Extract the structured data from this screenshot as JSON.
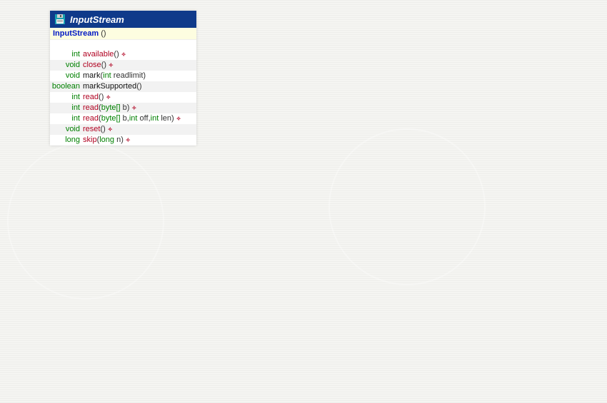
{
  "header": {
    "title": "InputStream",
    "icon": "floppy-disk-icon"
  },
  "constructor": {
    "name": "InputStream",
    "params": "()"
  },
  "methods": [
    {
      "ret": "int",
      "name": "available",
      "nameColor": "red",
      "params": [],
      "throws": true
    },
    {
      "ret": "void",
      "name": "close",
      "nameColor": "red",
      "params": [],
      "throws": true
    },
    {
      "ret": "void",
      "name": "mark",
      "nameColor": "black",
      "params": [
        {
          "type": "int",
          "name": "readlimit"
        }
      ],
      "throws": false
    },
    {
      "ret": "boolean",
      "name": "markSupported",
      "nameColor": "black",
      "params": [],
      "throws": false
    },
    {
      "ret": "int",
      "name": "read",
      "nameColor": "red",
      "params": [],
      "throws": true
    },
    {
      "ret": "int",
      "name": "read",
      "nameColor": "red",
      "params": [
        {
          "type": "byte[]",
          "name": "b"
        }
      ],
      "throws": true
    },
    {
      "ret": "int",
      "name": "read",
      "nameColor": "red",
      "params": [
        {
          "type": "byte[]",
          "name": "b"
        },
        {
          "type": "int",
          "name": "off"
        },
        {
          "type": "int",
          "name": "len"
        }
      ],
      "throws": true
    },
    {
      "ret": "void",
      "name": "reset",
      "nameColor": "red",
      "params": [],
      "throws": true
    },
    {
      "ret": "long",
      "name": "skip",
      "nameColor": "red",
      "params": [
        {
          "type": "long",
          "name": "n"
        }
      ],
      "throws": true
    }
  ],
  "flagGlyph": "✧"
}
